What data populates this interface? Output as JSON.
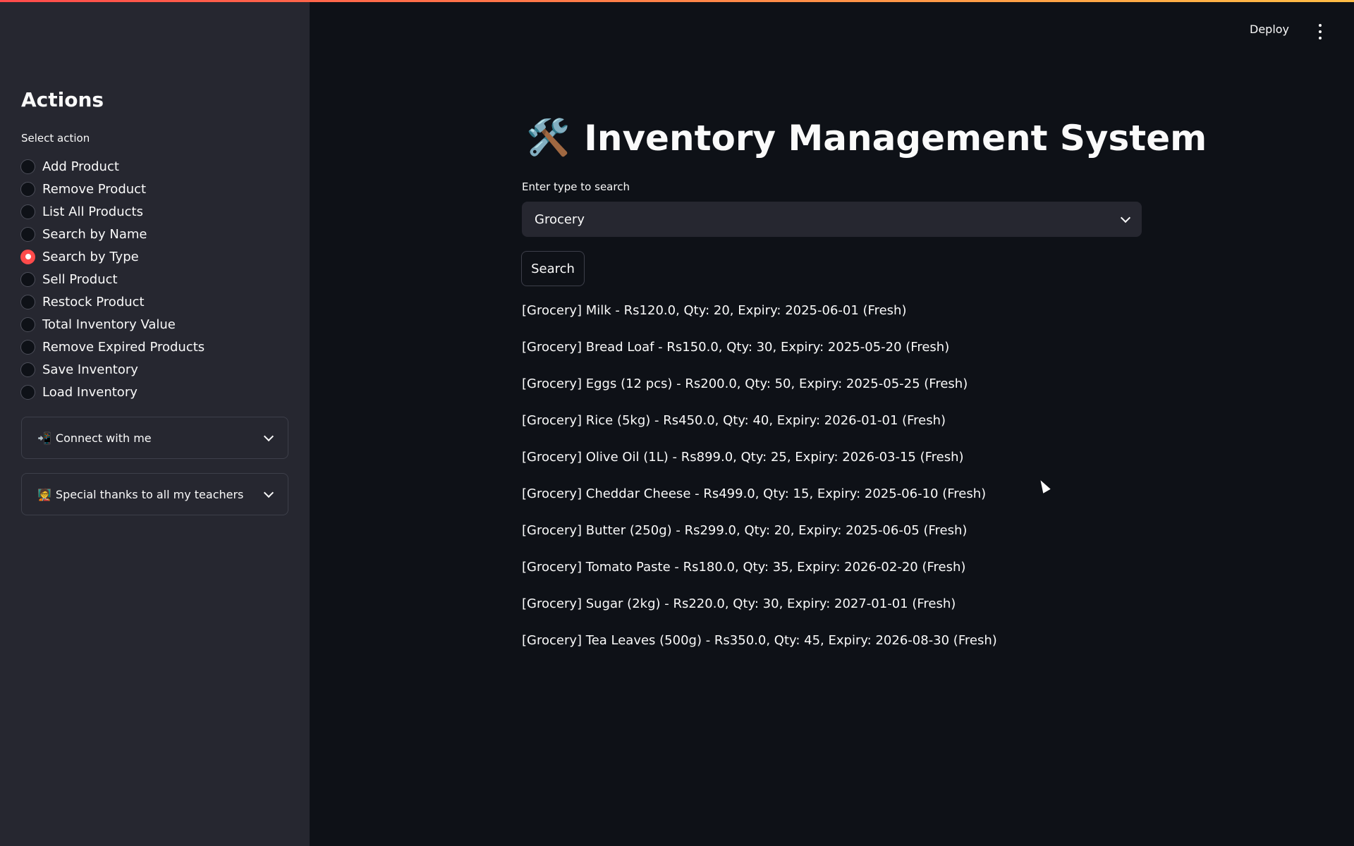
{
  "sidebar": {
    "heading": "Actions",
    "radio_label": "Select action",
    "options": [
      {
        "label": "Add Product",
        "selected": false
      },
      {
        "label": "Remove Product",
        "selected": false
      },
      {
        "label": "List All Products",
        "selected": false
      },
      {
        "label": "Search by Name",
        "selected": false
      },
      {
        "label": "Search by Type",
        "selected": true
      },
      {
        "label": "Sell Product",
        "selected": false
      },
      {
        "label": "Restock Product",
        "selected": false
      },
      {
        "label": "Total Inventory Value",
        "selected": false
      },
      {
        "label": "Remove Expired Products",
        "selected": false
      },
      {
        "label": "Save Inventory",
        "selected": false
      },
      {
        "label": "Load Inventory",
        "selected": false
      }
    ],
    "expanders": [
      {
        "emoji": "📲",
        "label": "Connect with me"
      },
      {
        "emoji": "🧑‍🏫",
        "label": "Special thanks to all my teachers"
      }
    ]
  },
  "header": {
    "deploy_label": "Deploy"
  },
  "main": {
    "title_emoji": "🛠️",
    "title": "Inventory Management System",
    "select_label": "Enter type to search",
    "select_value": "Grocery",
    "search_button": "Search",
    "results": [
      "[Grocery] Milk - Rs120.0, Qty: 20, Expiry: 2025-06-01 (Fresh)",
      "[Grocery] Bread Loaf - Rs150.0, Qty: 30, Expiry: 2025-05-20 (Fresh)",
      "[Grocery] Eggs (12 pcs) - Rs200.0, Qty: 50, Expiry: 2025-05-25 (Fresh)",
      "[Grocery] Rice (5kg) - Rs450.0, Qty: 40, Expiry: 2026-01-01 (Fresh)",
      "[Grocery] Olive Oil (1L) - Rs899.0, Qty: 25, Expiry: 2026-03-15 (Fresh)",
      "[Grocery] Cheddar Cheese - Rs499.0, Qty: 15, Expiry: 2025-06-10 (Fresh)",
      "[Grocery] Butter (250g) - Rs299.0, Qty: 20, Expiry: 2025-06-05 (Fresh)",
      "[Grocery] Tomato Paste - Rs180.0, Qty: 35, Expiry: 2026-02-20 (Fresh)",
      "[Grocery] Sugar (2kg) - Rs220.0, Qty: 30, Expiry: 2027-01-01 (Fresh)",
      "[Grocery] Tea Leaves (500g) - Rs350.0, Qty: 45, Expiry: 2026-08-30 (Fresh)"
    ]
  },
  "colors": {
    "accent": "#ff4b4b",
    "background": "#0e1117",
    "sidebar": "#262730"
  }
}
